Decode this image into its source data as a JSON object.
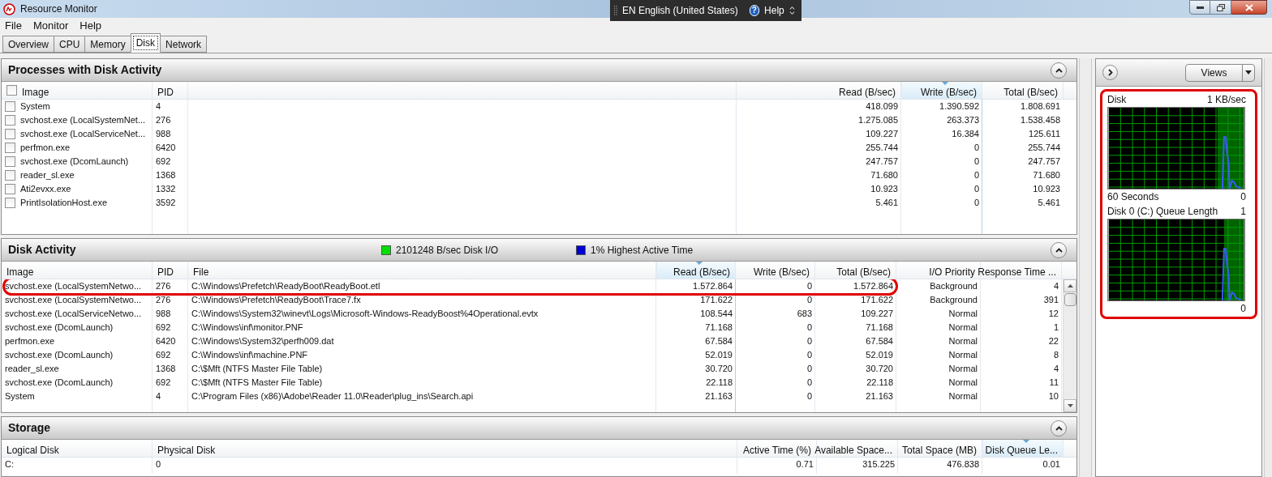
{
  "window": {
    "title": "Resource Monitor"
  },
  "language_bar": {
    "language": "EN English (United States)",
    "help_icon": "?",
    "help": "Help"
  },
  "menu": [
    "File",
    "Monitor",
    "Help"
  ],
  "tabs": [
    {
      "label": "Overview",
      "selected": false
    },
    {
      "label": "CPU",
      "selected": false
    },
    {
      "label": "Memory",
      "selected": false
    },
    {
      "label": "Disk",
      "selected": true
    },
    {
      "label": "Network",
      "selected": false
    }
  ],
  "processes": {
    "title": "Processes with Disk Activity",
    "header_checked": false,
    "columns": [
      {
        "label": "Image",
        "sorted": false
      },
      {
        "label": "PID",
        "sorted": false
      },
      {
        "sorted": false
      },
      {
        "label": "Read (B/sec)",
        "sorted": false
      },
      {
        "label": "Write (B/sec)",
        "sorted": true
      },
      {
        "label": "Total (B/sec)",
        "sorted": false
      }
    ],
    "rows": [
      {
        "checked": false,
        "cells": [
          "System",
          "4",
          "",
          "418.099",
          "1.390.592",
          "1.808.691"
        ]
      },
      {
        "checked": false,
        "cells": [
          "svchost.exe (LocalSystemNet...",
          "276",
          "",
          "1.275.085",
          "263.373",
          "1.538.458"
        ]
      },
      {
        "checked": false,
        "cells": [
          "svchost.exe (LocalServiceNet...",
          "988",
          "",
          "109.227",
          "16.384",
          "125.611"
        ]
      },
      {
        "checked": false,
        "cells": [
          "perfmon.exe",
          "6420",
          "",
          "255.744",
          "0",
          "255.744"
        ]
      },
      {
        "checked": false,
        "cells": [
          "svchost.exe (DcomLaunch)",
          "692",
          "",
          "247.757",
          "0",
          "247.757"
        ]
      },
      {
        "checked": false,
        "cells": [
          "reader_sl.exe",
          "1368",
          "",
          "71.680",
          "0",
          "71.680"
        ]
      },
      {
        "checked": false,
        "cells": [
          "Ati2evxx.exe",
          "1332",
          "",
          "10.923",
          "0",
          "10.923"
        ]
      },
      {
        "checked": false,
        "cells": [
          "PrintIsolationHost.exe",
          "3592",
          "",
          "5.461",
          "0",
          "5.461"
        ]
      }
    ]
  },
  "disk_activity": {
    "title": "Disk Activity",
    "legend": [
      {
        "label": "2101248 B/sec Disk I/O",
        "color": "#00e000"
      },
      {
        "label": "1% Highest Active Time",
        "color": "#0000d0"
      }
    ],
    "columns": [
      {
        "label": "Image",
        "sorted": false
      },
      {
        "label": "PID",
        "sorted": false
      },
      {
        "label": "File",
        "sorted": false
      },
      {
        "label": "Read (B/sec)",
        "sorted": true
      },
      {
        "label": "Write (B/sec)",
        "sorted": false
      },
      {
        "label": "Total (B/sec)",
        "sorted": false
      },
      {
        "label": "I/O Priority",
        "sorted": false
      },
      {
        "label": "Response Time ...",
        "sorted": false
      }
    ],
    "rows": [
      {
        "annotated": true,
        "cells": [
          "svchost.exe (LocalSystemNetwo...",
          "276",
          "C:\\Windows\\Prefetch\\ReadyBoot\\ReadyBoot.etl",
          "1.572.864",
          "0",
          "1.572.864",
          "Background",
          "4"
        ]
      },
      {
        "annotated": false,
        "cells": [
          "svchost.exe (LocalSystemNetwo...",
          "276",
          "C:\\Windows\\Prefetch\\ReadyBoot\\Trace7.fx",
          "171.622",
          "0",
          "171.622",
          "Background",
          "391"
        ]
      },
      {
        "annotated": false,
        "cells": [
          "svchost.exe (LocalServiceNetwo...",
          "988",
          "C:\\Windows\\System32\\winevt\\Logs\\Microsoft-Windows-ReadyBoost%4Operational.evtx",
          "108.544",
          "683",
          "109.227",
          "Normal",
          "12"
        ]
      },
      {
        "annotated": false,
        "cells": [
          "svchost.exe (DcomLaunch)",
          "692",
          "C:\\Windows\\inf\\monitor.PNF",
          "71.168",
          "0",
          "71.168",
          "Normal",
          "1"
        ]
      },
      {
        "annotated": false,
        "cells": [
          "perfmon.exe",
          "6420",
          "C:\\Windows\\System32\\perfh009.dat",
          "67.584",
          "0",
          "67.584",
          "Normal",
          "22"
        ]
      },
      {
        "annotated": false,
        "cells": [
          "svchost.exe (DcomLaunch)",
          "692",
          "C:\\Windows\\inf\\machine.PNF",
          "52.019",
          "0",
          "52.019",
          "Normal",
          "8"
        ]
      },
      {
        "annotated": false,
        "cells": [
          "reader_sl.exe",
          "1368",
          "C:\\$Mft (NTFS Master File Table)",
          "30.720",
          "0",
          "30.720",
          "Normal",
          "4"
        ]
      },
      {
        "annotated": false,
        "cells": [
          "svchost.exe (DcomLaunch)",
          "692",
          "C:\\$Mft (NTFS Master File Table)",
          "22.118",
          "0",
          "22.118",
          "Normal",
          "11"
        ]
      },
      {
        "annotated": false,
        "cells": [
          "System",
          "4",
          "C:\\Program Files (x86)\\Adobe\\Reader 11.0\\Reader\\plug_ins\\Search.api",
          "21.163",
          "0",
          "21.163",
          "Normal",
          "10"
        ]
      }
    ]
  },
  "storage": {
    "title": "Storage",
    "columns": [
      {
        "label": "Logical Disk",
        "sorted": false
      },
      {
        "label": "Physical Disk",
        "sorted": false
      },
      {
        "label": "Active Time (%)",
        "sorted": false
      },
      {
        "label": "Available Space...",
        "sorted": false
      },
      {
        "label": "Total Space (MB)",
        "sorted": false
      },
      {
        "label": "Disk Queue Le...",
        "sorted": true
      }
    ],
    "rows": [
      {
        "cells": [
          "C:",
          "0",
          "0.71",
          "315.225",
          "476.838",
          "0.01"
        ]
      }
    ]
  },
  "side_panel": {
    "views_button": "Views",
    "annotated": true,
    "graphs": [
      {
        "title": "Disk",
        "scale_max": "1 KB/sec",
        "time_label": "60 Seconds",
        "scale_min": "0"
      },
      {
        "title": "Disk 0 (C:) Queue Length",
        "scale_max": "1",
        "scale_min": "0"
      }
    ]
  }
}
